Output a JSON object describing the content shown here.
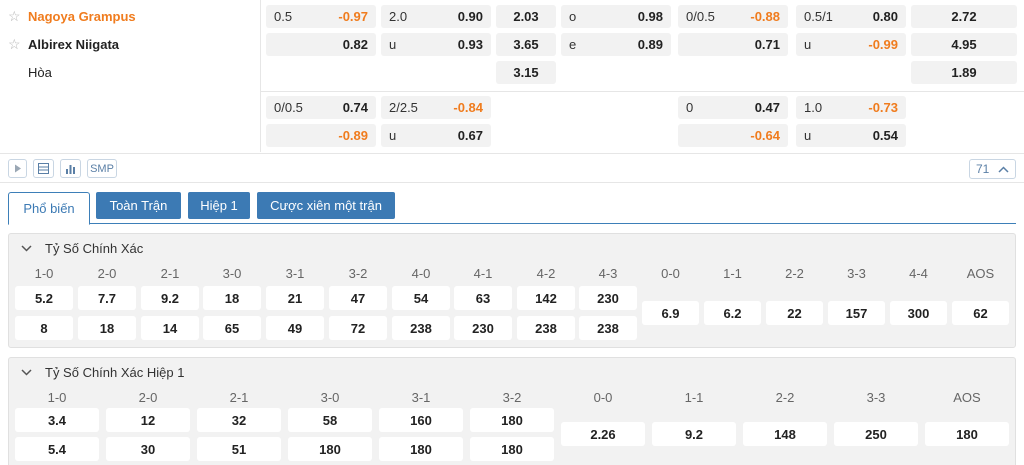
{
  "teams": {
    "home": "Nagoya Grampus",
    "away": "Albirex Niigata",
    "draw": "Hòa"
  },
  "odds": {
    "row1": [
      "0.5",
      "-0.97",
      "2.0",
      "0.90",
      "2.03",
      "o",
      "0.98",
      "0/0.5",
      "-0.88",
      "0.5/1",
      "0.80",
      "2.72"
    ],
    "row2": [
      "0.82",
      "u",
      "0.93",
      "3.65",
      "e",
      "0.89",
      "0.71",
      "u",
      "-0.99",
      "4.95"
    ],
    "row3": [
      "3.15",
      "1.89"
    ],
    "row4": [
      "0/0.5",
      "0.74",
      "2/2.5",
      "-0.84",
      "0",
      "0.47",
      "1.0",
      "-0.73"
    ],
    "row5": [
      "-0.89",
      "u",
      "0.67",
      "-0.64",
      "u",
      "0.54"
    ]
  },
  "toolbar": {
    "smp_label": "SMP",
    "count": "71"
  },
  "tabs": [
    "Phổ biến",
    "Toàn Trận",
    "Hiệp 1",
    "Cược xiên một trận"
  ],
  "correct_score": {
    "title": "Tỷ Số Chính Xác",
    "left_headers": [
      "1-0",
      "2-0",
      "2-1",
      "3-0",
      "3-1",
      "3-2",
      "4-0",
      "4-1",
      "4-2",
      "4-3"
    ],
    "left_row1": [
      "5.2",
      "7.7",
      "9.2",
      "18",
      "21",
      "47",
      "54",
      "63",
      "142",
      "230"
    ],
    "left_row2": [
      "8",
      "18",
      "14",
      "65",
      "49",
      "72",
      "238",
      "230",
      "238",
      "238"
    ],
    "right_headers": [
      "0-0",
      "1-1",
      "2-2",
      "3-3",
      "4-4",
      "AOS"
    ],
    "right_values": [
      "6.9",
      "6.2",
      "22",
      "157",
      "300",
      "62"
    ]
  },
  "correct_score_h1": {
    "title": "Tỷ Số Chính Xác Hiệp 1",
    "left_headers": [
      "1-0",
      "2-0",
      "2-1",
      "3-0",
      "3-1",
      "3-2"
    ],
    "left_row1": [
      "3.4",
      "12",
      "32",
      "58",
      "160",
      "180"
    ],
    "left_row2": [
      "5.4",
      "30",
      "51",
      "180",
      "180",
      "180"
    ],
    "right_headers": [
      "0-0",
      "1-1",
      "2-2",
      "3-3",
      "AOS"
    ],
    "right_values": [
      "2.26",
      "9.2",
      "148",
      "250",
      "180"
    ]
  },
  "colors": {
    "accent": "#3c7ab4",
    "negative": "#f07c1e",
    "home_team": "#f07c1e"
  }
}
